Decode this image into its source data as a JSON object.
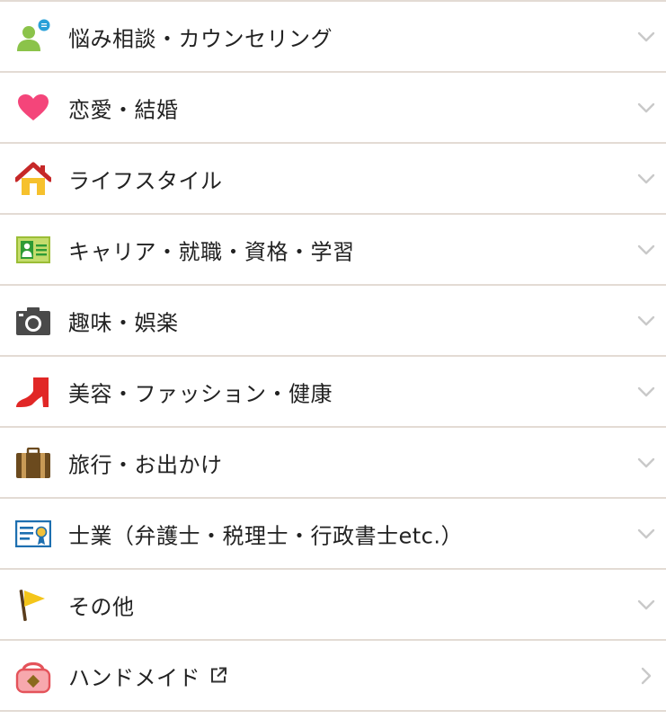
{
  "categories": [
    {
      "label": "悩み相談・カウンセリング",
      "icon": "counseling-person-icon",
      "indicator": "chevron-down-icon"
    },
    {
      "label": "恋愛・結婚",
      "icon": "heart-icon",
      "indicator": "chevron-down-icon"
    },
    {
      "label": "ライフスタイル",
      "icon": "house-icon",
      "indicator": "chevron-down-icon"
    },
    {
      "label": "キャリア・就職・資格・学習",
      "icon": "id-card-icon",
      "indicator": "chevron-down-icon"
    },
    {
      "label": "趣味・娯楽",
      "icon": "camera-icon",
      "indicator": "chevron-down-icon"
    },
    {
      "label": "美容・ファッション・健康",
      "icon": "high-heel-icon",
      "indicator": "chevron-down-icon"
    },
    {
      "label": "旅行・お出かけ",
      "icon": "suitcase-icon",
      "indicator": "chevron-down-icon"
    },
    {
      "label": "士業（弁護士・税理士・行政書士etc.）",
      "icon": "certificate-icon",
      "indicator": "chevron-down-icon"
    },
    {
      "label": "その他",
      "icon": "flag-icon",
      "indicator": "chevron-down-icon"
    },
    {
      "label": "ハンドメイド",
      "icon": "handbag-icon",
      "indicator": "chevron-right-icon",
      "external_icon": "external-link-icon"
    }
  ],
  "colors": {
    "divider": "#e3dbd4",
    "text": "#222222",
    "chevron": "#c9c9c9"
  }
}
